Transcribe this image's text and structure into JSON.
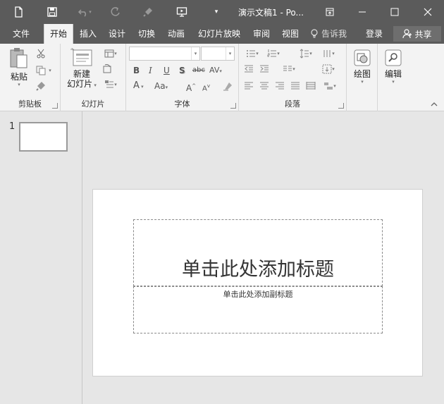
{
  "titlebar": {
    "title": "演示文稿1 - Po...",
    "icons": [
      "new-file-icon",
      "save-icon",
      "undo-icon",
      "redo-icon",
      "format-painter-icon",
      "slideshow-icon",
      "customize-icon"
    ]
  },
  "tabs": [
    {
      "label": "文件"
    },
    {
      "label": "开始",
      "active": true
    },
    {
      "label": "插入"
    },
    {
      "label": "设计"
    },
    {
      "label": "切换"
    },
    {
      "label": "动画"
    },
    {
      "label": "幻灯片放映"
    },
    {
      "label": "审阅"
    },
    {
      "label": "视图"
    }
  ],
  "tellme": "告诉我",
  "signin": "登录",
  "share": "共享",
  "ribbon": {
    "clipboard": {
      "label": "剪贴板",
      "paste": "粘贴"
    },
    "slides": {
      "label": "幻灯片",
      "new_slide_line1": "新建",
      "new_slide_line2": "幻灯片"
    },
    "font": {
      "label": "字体",
      "font_name": "",
      "font_size": ""
    },
    "paragraph": {
      "label": "段落"
    },
    "drawing": {
      "label": "绘图"
    },
    "editing": {
      "label": "编辑"
    }
  },
  "slides_pane": {
    "slide_number": "1"
  },
  "slide": {
    "title_placeholder": "单击此处添加标题",
    "subtitle_placeholder": "单击此处添加副标题"
  },
  "colors": {
    "titlebar": "#5b5b5b",
    "ribbon": "#f3f3f3",
    "workspace": "#e6e6e6"
  }
}
